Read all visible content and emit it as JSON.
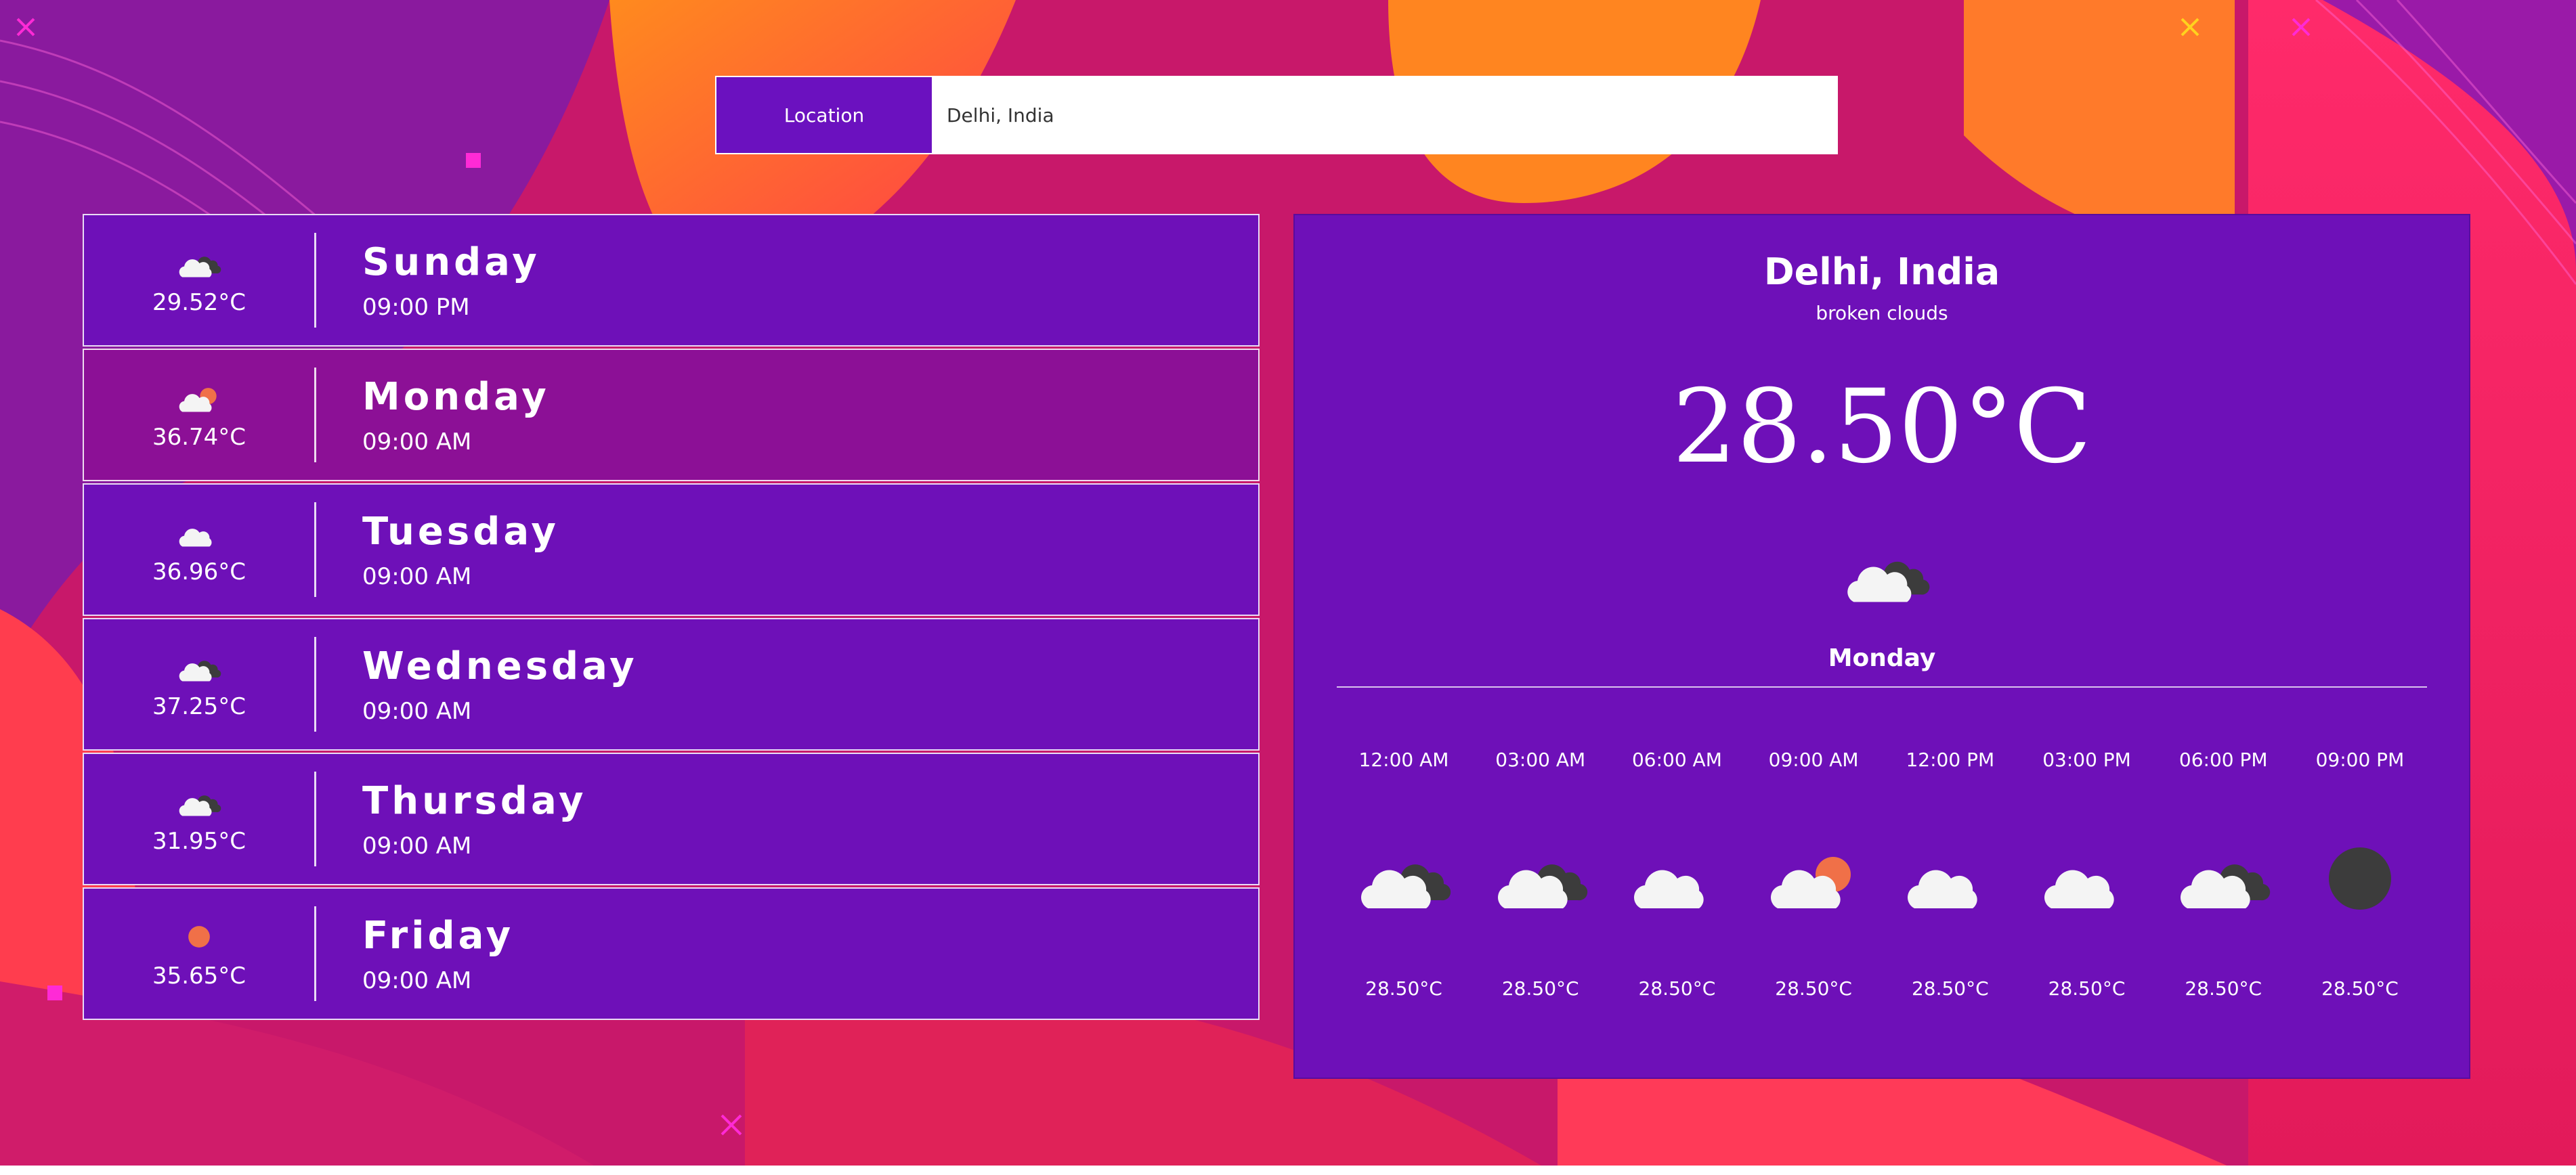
{
  "search": {
    "button_label": "Location",
    "value": "Delhi, India"
  },
  "forecast": [
    {
      "day": "Sunday",
      "time": "09:00 PM",
      "temp": "29.52°C",
      "icon": "broken-clouds-icon"
    },
    {
      "day": "Monday",
      "time": "09:00 AM",
      "temp": "36.74°C",
      "icon": "few-clouds-icon"
    },
    {
      "day": "Tuesday",
      "time": "09:00 AM",
      "temp": "36.96°C",
      "icon": "cloud-icon"
    },
    {
      "day": "Wednesday",
      "time": "09:00 AM",
      "temp": "37.25°C",
      "icon": "broken-clouds-icon"
    },
    {
      "day": "Thursday",
      "time": "09:00 AM",
      "temp": "31.95°C",
      "icon": "broken-clouds-icon"
    },
    {
      "day": "Friday",
      "time": "09:00 AM",
      "temp": "35.65°C",
      "icon": "clear-sky-icon"
    }
  ],
  "detail": {
    "city": "Delhi, India",
    "description": "broken clouds",
    "temperature": "28.50",
    "unit": "°C",
    "icon": "broken-clouds-icon",
    "selected_day": "Monday",
    "hourly": [
      {
        "time": "12:00 AM",
        "temp": "28.50°C",
        "icon": "broken-clouds-icon"
      },
      {
        "time": "03:00 AM",
        "temp": "28.50°C",
        "icon": "broken-clouds-icon"
      },
      {
        "time": "06:00 AM",
        "temp": "28.50°C",
        "icon": "cloud-icon"
      },
      {
        "time": "09:00 AM",
        "temp": "28.50°C",
        "icon": "few-clouds-icon"
      },
      {
        "time": "12:00 PM",
        "temp": "28.50°C",
        "icon": "cloud-icon"
      },
      {
        "time": "03:00 PM",
        "temp": "28.50°C",
        "icon": "cloud-icon"
      },
      {
        "time": "06:00 PM",
        "temp": "28.50°C",
        "icon": "broken-clouds-icon"
      },
      {
        "time": "09:00 PM",
        "temp": "28.50°C",
        "icon": "night-icon"
      }
    ]
  },
  "colors": {
    "accent_purple": "#6e10b8",
    "active_row": "#8c1096",
    "sun": "#f07048",
    "dark_cloud": "#3c3c3c"
  }
}
